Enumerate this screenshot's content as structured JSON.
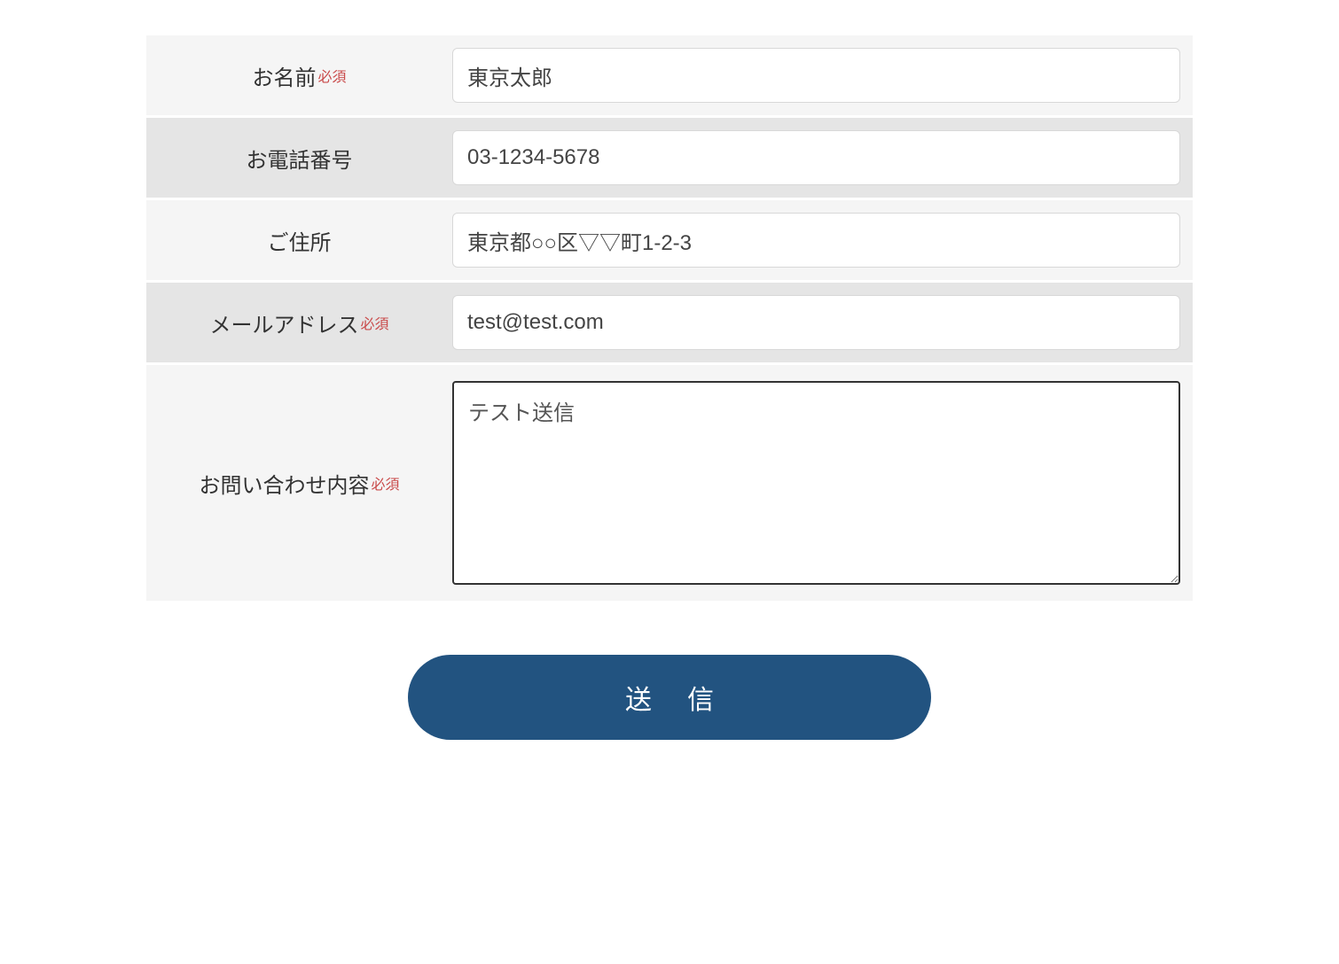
{
  "form": {
    "required_label": "必須",
    "fields": {
      "name": {
        "label": "お名前",
        "required": true,
        "value": "東京太郎"
      },
      "phone": {
        "label": "お電話番号",
        "required": false,
        "value": "03-1234-5678"
      },
      "address": {
        "label": "ご住所",
        "required": false,
        "value": "東京都○○区▽▽町1-2-3"
      },
      "email": {
        "label": "メールアドレス",
        "required": true,
        "value": "test@test.com"
      },
      "inquiry": {
        "label": "お問い合わせ内容",
        "required": true,
        "value": "テスト送信"
      }
    },
    "submit_label": "送信"
  }
}
